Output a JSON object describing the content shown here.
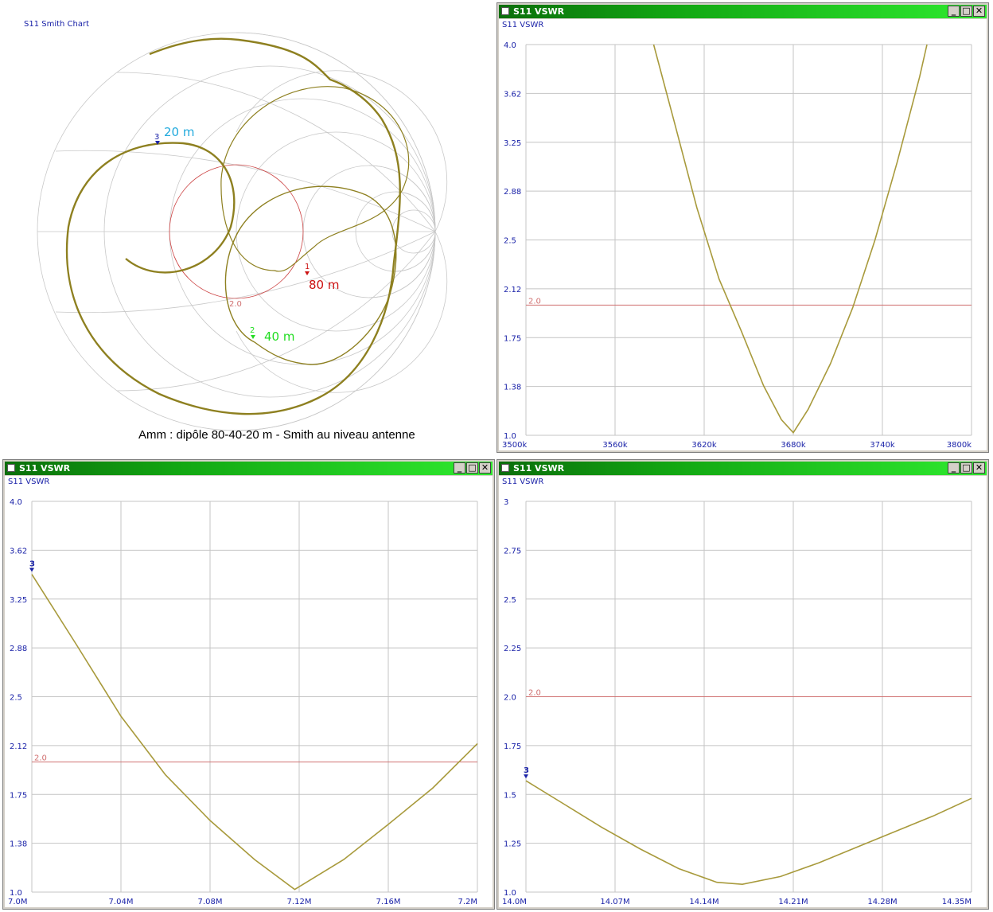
{
  "colors": {
    "trace": "#a89a3c",
    "ref": "#d07070",
    "axis_text": "#1a22a8",
    "titlebar": "#12a612",
    "smith_trace": "#8e8020"
  },
  "window_buttons": {
    "minimize": "_",
    "maximize": "□",
    "close": "✕"
  },
  "smith": {
    "title": "S11 Smith Chart",
    "caption": "Amm : dipôle 80-40-20 m - Smith au niveau antenne",
    "vswr_circle_label": "2.0",
    "markers": [
      {
        "num": "1",
        "label": "80 m",
        "color": "#cc1111"
      },
      {
        "num": "2",
        "label": "40 m",
        "color": "#22dd22"
      },
      {
        "num": "3",
        "label": "20 m",
        "color": "#22aadd"
      }
    ]
  },
  "chart_data": [
    {
      "type": "line",
      "window_title": "S11 VSWR",
      "title": "S11 VSWR",
      "x_ticks": [
        "3500k",
        "3560k",
        "3620k",
        "3680k",
        "3740k",
        "3800k"
      ],
      "xlim": [
        3500,
        3800
      ],
      "y_ticks": [
        "4.0",
        "3.62",
        "3.25",
        "2.88",
        "2.5",
        "2.12",
        "1.75",
        "1.38",
        "1.0"
      ],
      "ylim": [
        1.0,
        4.0
      ],
      "ref_line": {
        "value": 2.0,
        "label": "2.0"
      },
      "series": [
        {
          "x": [
            3586,
            3600,
            3615,
            3630,
            3645,
            3660,
            3672,
            3680,
            3690,
            3705,
            3720,
            3735,
            3750,
            3765,
            3770
          ],
          "y": [
            4.0,
            3.4,
            2.75,
            2.2,
            1.8,
            1.38,
            1.12,
            1.02,
            1.2,
            1.55,
            1.98,
            2.5,
            3.1,
            3.75,
            4.0
          ]
        }
      ]
    },
    {
      "type": "line",
      "window_title": "S11 VSWR",
      "title": "S11 VSWR",
      "x_ticks": [
        "7.0M",
        "7.04M",
        "7.08M",
        "7.12M",
        "7.16M",
        "7.2M"
      ],
      "xlim": [
        7.0,
        7.2
      ],
      "y_ticks": [
        "4.0",
        "3.62",
        "3.25",
        "2.88",
        "2.5",
        "2.12",
        "1.75",
        "1.38",
        "1.0"
      ],
      "ylim": [
        1.0,
        4.0
      ],
      "ref_line": {
        "value": 2.0,
        "label": "2.0"
      },
      "marker": {
        "label": "3",
        "x": 7.0,
        "y": 3.44
      },
      "series": [
        {
          "x": [
            7.0,
            7.02,
            7.04,
            7.06,
            7.08,
            7.1,
            7.118,
            7.14,
            7.16,
            7.18,
            7.2
          ],
          "y": [
            3.44,
            2.9,
            2.35,
            1.9,
            1.55,
            1.25,
            1.02,
            1.25,
            1.52,
            1.8,
            2.14
          ]
        }
      ]
    },
    {
      "type": "line",
      "window_title": "S11 VSWR",
      "title": "S11 VSWR",
      "x_ticks": [
        "14.0M",
        "14.07M",
        "14.14M",
        "14.21M",
        "14.28M",
        "14.35M"
      ],
      "xlim": [
        14.0,
        14.35
      ],
      "y_ticks": [
        "3",
        "2.75",
        "2.5",
        "2.25",
        "2.0",
        "1.75",
        "1.5",
        "1.25",
        "1.0"
      ],
      "ylim": [
        1.0,
        3.0
      ],
      "ref_line": {
        "value": 2.0,
        "label": "2.0"
      },
      "marker": {
        "label": "3",
        "x": 14.0,
        "y": 1.57
      },
      "series": [
        {
          "x": [
            14.0,
            14.03,
            14.06,
            14.09,
            14.12,
            14.15,
            14.17,
            14.2,
            14.23,
            14.26,
            14.29,
            14.32,
            14.35
          ],
          "y": [
            1.57,
            1.45,
            1.33,
            1.22,
            1.12,
            1.05,
            1.04,
            1.08,
            1.15,
            1.23,
            1.31,
            1.39,
            1.48
          ]
        }
      ]
    }
  ]
}
